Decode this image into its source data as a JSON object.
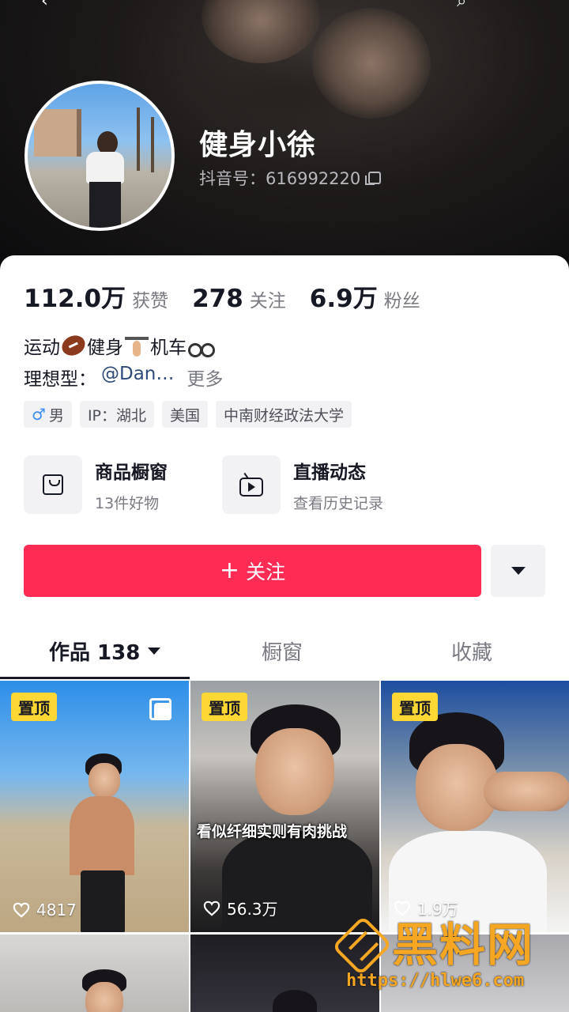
{
  "profile": {
    "name": "健身小徐",
    "uid_label": "抖音号：616992220"
  },
  "stats": [
    {
      "num": "112.0万",
      "label": "获赞"
    },
    {
      "num": "278",
      "label": "关注"
    },
    {
      "num": "6.9万",
      "label": "粉丝"
    }
  ],
  "bio": {
    "line1": [
      "运动",
      "健身",
      "机车"
    ],
    "line2_prefix": "理想型：",
    "line2_mention": "@Dan…",
    "line2_more": "更多"
  },
  "tags": {
    "gender_symbol": "♂",
    "gender": "男",
    "ip": "IP：湖北",
    "country": "美国",
    "school": "中南财经政法大学"
  },
  "entries": {
    "shop": {
      "title": "商品橱窗",
      "sub": "13件好物",
      "icon": "shopping-bag-icon"
    },
    "live": {
      "title": "直播动态",
      "sub": "查看历史记录",
      "icon": "tv-icon"
    }
  },
  "actions": {
    "follow_label": "关注",
    "follow_color": "#fe2c55"
  },
  "tabs": {
    "works": "作品 138",
    "showcase": "橱窗",
    "favorites": "收藏"
  },
  "videos": [
    {
      "pinned": "置顶",
      "likes": "4817"
    },
    {
      "pinned": "置顶",
      "likes": "56.3万",
      "caption": "看似纤细实则有肉挑战"
    },
    {
      "pinned": "置顶",
      "likes": "1.9万"
    }
  ],
  "watermark": {
    "title": "黑料网",
    "url": "https://hlwe6.com"
  }
}
